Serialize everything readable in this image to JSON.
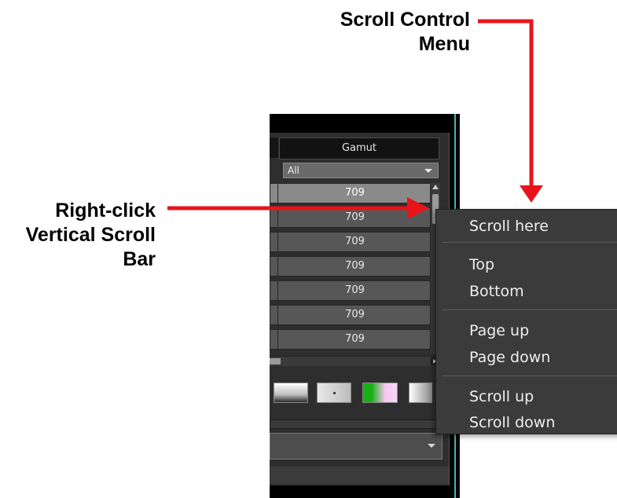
{
  "annotations": {
    "menu_callout": "Scroll Control\nMenu",
    "scrollbar_callout": "Right-click\nVertical Scroll\nBar"
  },
  "table": {
    "column_header": "Gamut",
    "filter_value": "All",
    "rows": [
      "709",
      "709",
      "709",
      "709",
      "709",
      "709",
      "709"
    ],
    "selected_row_index": 0
  },
  "context_menu": {
    "items": [
      "Scroll here",
      "Top",
      "Bottom",
      "Page up",
      "Page down",
      "Scroll up",
      "Scroll down"
    ]
  },
  "colors": {
    "arrow": "#e8141b",
    "panel_accent": "#3fb9b3",
    "menu_bg": "#3b3b3b"
  }
}
